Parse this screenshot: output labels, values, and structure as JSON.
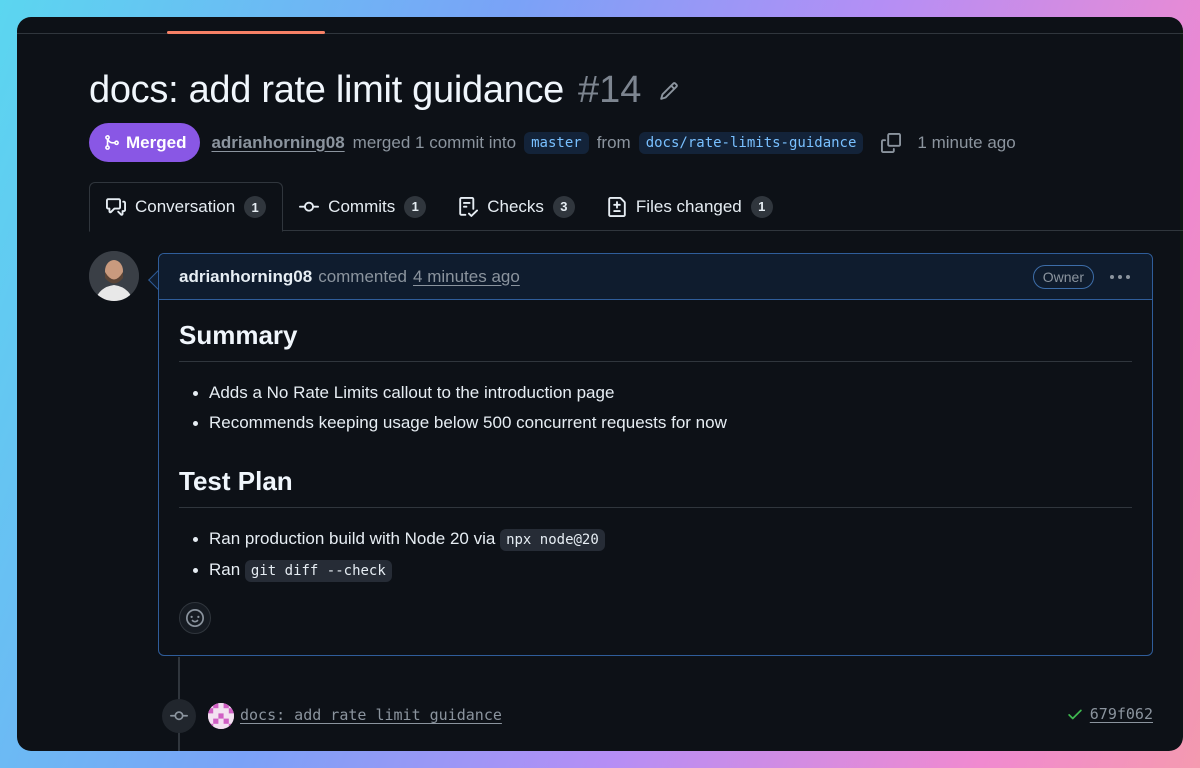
{
  "pr": {
    "title": "docs: add rate limit guidance",
    "number": "#14",
    "status": "Merged",
    "author": "adrianhorning08",
    "merge_text": "merged 1 commit into",
    "base_branch": "master",
    "from_text": "from",
    "head_branch": "docs/rate-limits-guidance",
    "time": "1 minute ago"
  },
  "tabs": [
    {
      "label": "Conversation",
      "count": "1",
      "icon": "comment-discussion-icon"
    },
    {
      "label": "Commits",
      "count": "1",
      "icon": "git-commit-icon"
    },
    {
      "label": "Checks",
      "count": "3",
      "icon": "checklist-icon"
    },
    {
      "label": "Files changed",
      "count": "1",
      "icon": "file-diff-icon"
    }
  ],
  "comment": {
    "author": "adrianhorning08",
    "action": "commented",
    "time": "4 minutes ago",
    "badge": "Owner",
    "sections": [
      {
        "heading": "Summary",
        "items": [
          {
            "text": "Adds a No Rate Limits callout to the introduction page"
          },
          {
            "text": "Recommends keeping usage below 500 concurrent requests for now"
          }
        ]
      },
      {
        "heading": "Test Plan",
        "items": [
          {
            "text": "Ran production build with Node 20 via",
            "code": "npx node@20"
          },
          {
            "text": "Ran",
            "code": "git diff --check"
          }
        ]
      }
    ]
  },
  "commit": {
    "message": "docs: add rate limit guidance",
    "sha": "679f062",
    "status": "success"
  },
  "colors": {
    "merged": "#8957e5",
    "accent_tab": "#f78166",
    "link_branch": "#79c0ff",
    "success": "#3fb950"
  }
}
